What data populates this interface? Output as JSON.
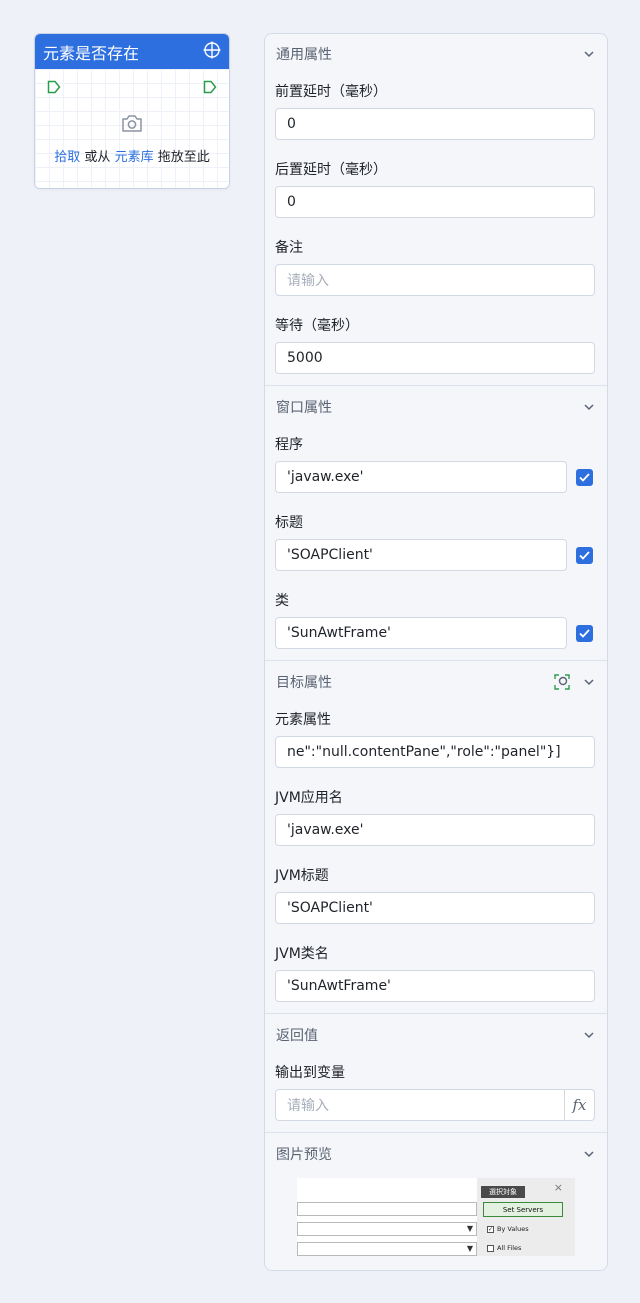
{
  "node": {
    "title": "元素是否存在",
    "pick_link": "拾取",
    "or_from": " 或从 ",
    "library_link": "元素库",
    "drag_hint": " 拖放至此"
  },
  "panel": {
    "general": {
      "header": "通用属性",
      "pre_delay_label": "前置延时（毫秒）",
      "pre_delay_value": "0",
      "post_delay_label": "后置延时（毫秒）",
      "post_delay_value": "0",
      "note_label": "备注",
      "note_placeholder": "请输入",
      "wait_label": "等待（毫秒）",
      "wait_value": "5000"
    },
    "window": {
      "header": "窗口属性",
      "program_label": "程序",
      "program_value": "'javaw.exe'",
      "title_label": "标题",
      "title_value": "'SOAPClient'",
      "class_label": "类",
      "class_value": "'SunAwtFrame'"
    },
    "target": {
      "header": "目标属性",
      "element_attr_label": "元素属性",
      "element_attr_value": "ne\":\"null.contentPane\",\"role\":\"panel\"}]",
      "jvm_app_label": "JVM应用名",
      "jvm_app_value": "'javaw.exe'",
      "jvm_title_label": "JVM标题",
      "jvm_title_value": "'SOAPClient'",
      "jvm_class_label": "JVM类名",
      "jvm_class_value": "'SunAwtFrame'"
    },
    "return": {
      "header": "返回值",
      "output_label": "输出到变量",
      "output_placeholder": "请输入",
      "fx_label": "fx"
    },
    "preview": {
      "header": "图片预览",
      "dialog_title": "選択対象",
      "close": "×",
      "button": "Set Servers",
      "check1": "By Values",
      "check2": "All Files"
    }
  },
  "colors": {
    "accent": "#2e6fe0",
    "port": "#2a9d4b"
  }
}
